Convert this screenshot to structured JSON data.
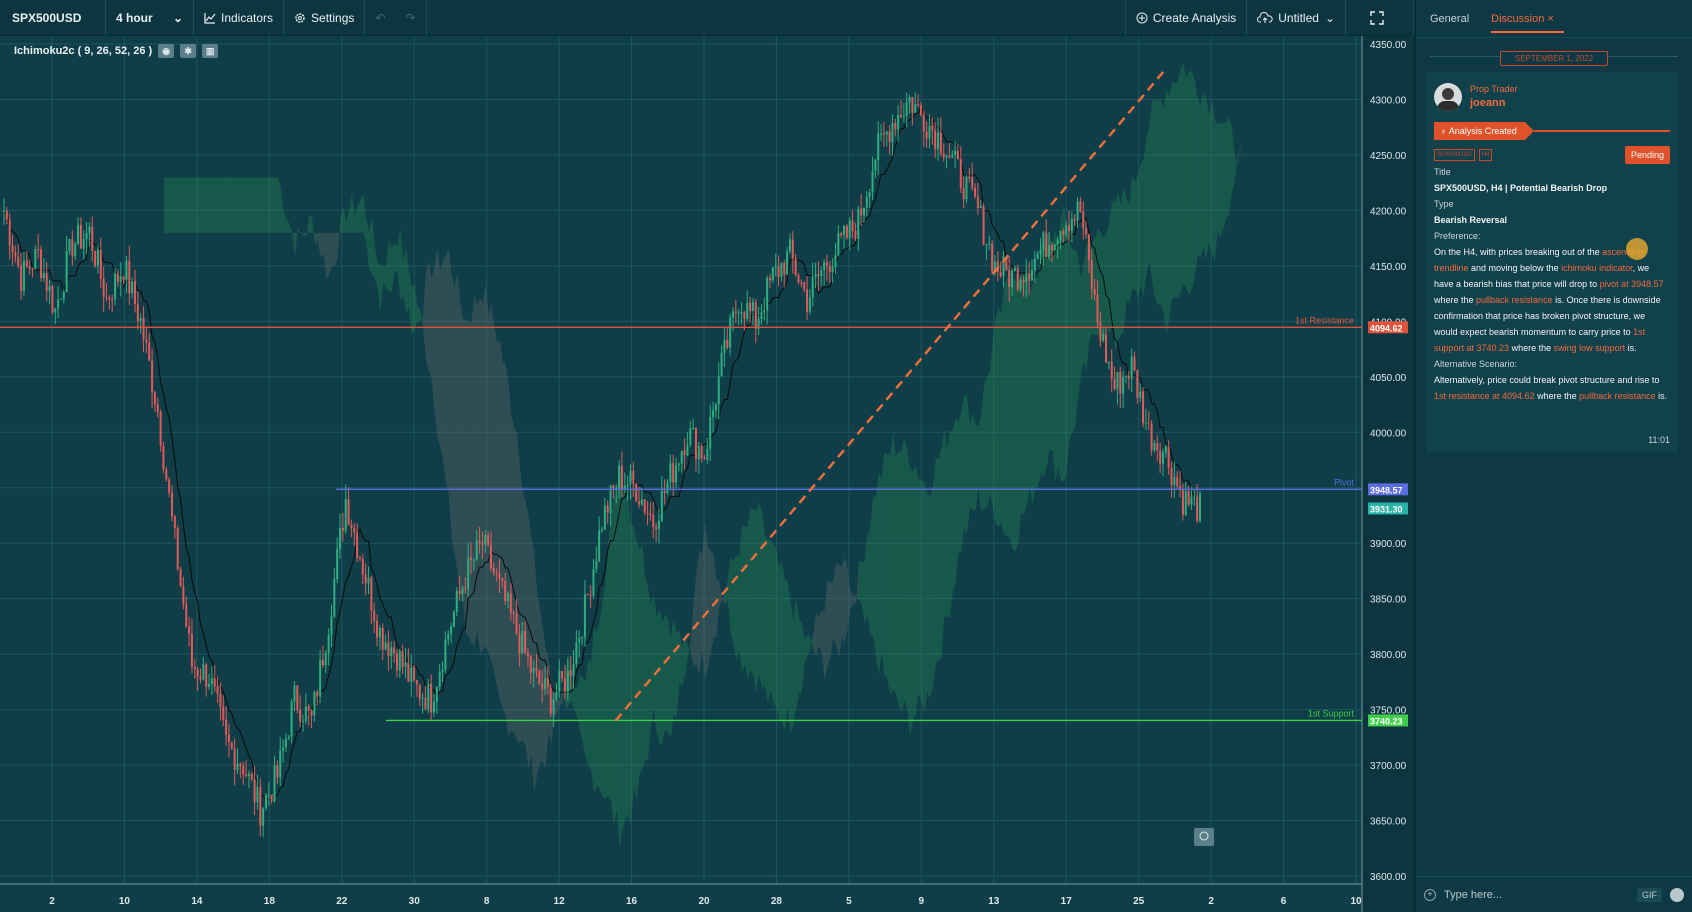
{
  "toolbar": {
    "symbol": "SPX500USD",
    "timeframe": "4 hour",
    "indicators": "Indicators",
    "settings": "Settings",
    "create_analysis": "Create Analysis",
    "untitled": "Untitled"
  },
  "indicator_label": "Ichimoku2c ( 9, 26, 52, 26 )",
  "chart_data": {
    "type": "candlestick",
    "symbol": "SPX500USD",
    "interval": "4 hour",
    "y_ticks": [
      "4350.00",
      "4300.00",
      "4250.00",
      "4200.00",
      "4150.00",
      "4100.00",
      "4050.00",
      "4000.00",
      "3950.00",
      "3900.00",
      "3850.00",
      "3800.00",
      "3750.00",
      "3700.00",
      "3650.00",
      "3600.00"
    ],
    "ylim": [
      3600,
      4350
    ],
    "x_ticks": [
      "2",
      "10",
      "14",
      "18",
      "22",
      "30",
      "8",
      "12",
      "16",
      "20",
      "28",
      "5",
      "9",
      "13",
      "17",
      "25",
      "2",
      "6",
      "10"
    ],
    "price_path": [
      4200,
      4140,
      4160,
      4110,
      4170,
      4180,
      4120,
      4150,
      4100,
      4020,
      3900,
      3790,
      3780,
      3720,
      3700,
      3660,
      3690,
      3760,
      3740,
      3830,
      3940,
      3880,
      3820,
      3800,
      3770,
      3760,
      3820,
      3870,
      3900,
      3860,
      3820,
      3780,
      3760,
      3780,
      3840,
      3920,
      3960,
      3950,
      3920,
      3960,
      4000,
      3980,
      4060,
      4120,
      4100,
      4140,
      4160,
      4120,
      4150,
      4170,
      4190,
      4250,
      4280,
      4300,
      4280,
      4260,
      4230,
      4200,
      4150,
      4140,
      4150,
      4170,
      4190,
      4200,
      4100,
      4040,
      4060,
      4000,
      3980,
      3940,
      3931
    ],
    "levels": [
      {
        "label": "1st Resistance",
        "value": 4094.62,
        "value_label": "4094.62",
        "color": "#e0533a"
      },
      {
        "label": "Pivot",
        "value": 3948.57,
        "value_label": "3948.57",
        "color": "#5b6be0"
      },
      {
        "label": "1st Support",
        "value": 3740.23,
        "value_label": "3740.23",
        "color": "#3fcf4a"
      }
    ],
    "current_price": {
      "value": 3931.3,
      "label": "3931.30",
      "color": "#28b3a8"
    },
    "trendline": {
      "from": [
        3740,
        "16"
      ],
      "to": [
        4328,
        "17"
      ],
      "color": "#f0703c",
      "style": "dashed"
    }
  },
  "panel": {
    "tabs": [
      "General",
      "Discussion"
    ],
    "date": "SEPTEMBER 1, 2022",
    "role": "Prop Trader",
    "username": "joeann",
    "created": "Analysis Created",
    "tags": [
      "SPX500USD",
      "H4"
    ],
    "status": "Pending",
    "title_label": "Title",
    "title": "SPX500USD, H4 | Potential Bearish Drop",
    "type_label": "Type",
    "type": "Bearish Reversal",
    "pref_label": "Preference:",
    "pref": {
      "p1": "On the H4, with prices breaking out of the ",
      "h1": "ascending trendline",
      "p2": " and moving below the ",
      "h2": "ichimoku indicator",
      "p3": ", we have a bearish bias that price will drop to ",
      "h3": "pivot at 3948.57",
      "p4": " where the ",
      "h4": "pullback resistance",
      "p5": " is. Once there is downside confirmation that price has broken pivot structure, we would expect bearish momentum to carry price to ",
      "h5": "1st support at 3740.23",
      "p6": " where the ",
      "h6": "swing low support",
      "p7": " is."
    },
    "alt_label": "Alternative Scenario:",
    "alt": {
      "p1": "Alternatively, price could break pivot structure and rise to ",
      "h1": "1st resistance at 4094.62",
      "p2": " where the ",
      "h2": "pullback resistance",
      "p3": " is."
    },
    "time": "11:01",
    "composer_placeholder": "Type here...",
    "gif": "GIF"
  }
}
